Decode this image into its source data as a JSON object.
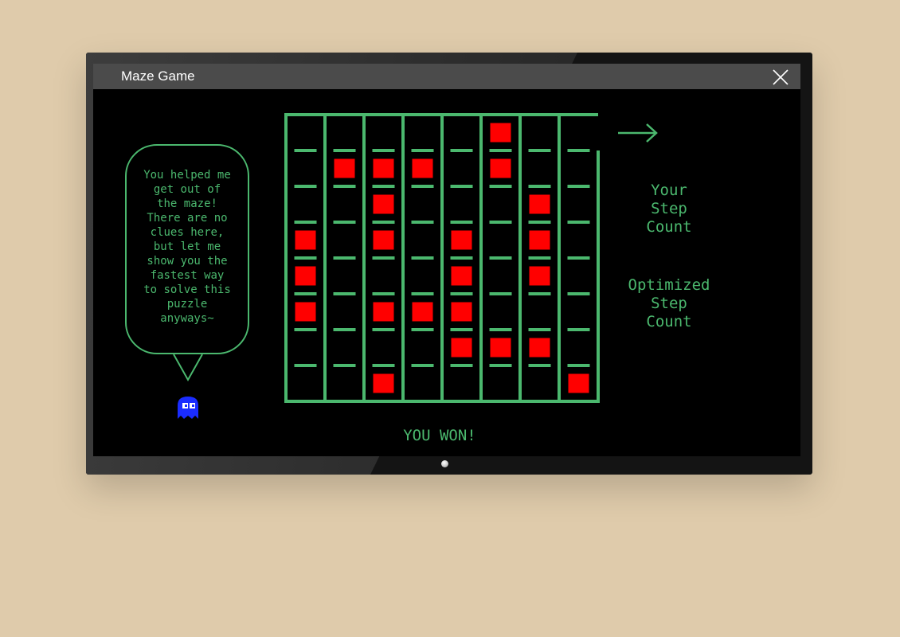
{
  "window": {
    "title": "Maze Game"
  },
  "speech_bubble": {
    "lines": [
      "You helped me",
      "get out of",
      "the maze!",
      "There are no",
      "clues here,",
      "but let me",
      "show you the",
      "fastest way",
      "to solve this",
      "puzzle",
      "anyways~"
    ]
  },
  "stats": {
    "step_count_label": [
      "Your",
      "Step",
      "Count"
    ],
    "optimized_label": [
      "Optimized",
      "Step",
      "Count"
    ]
  },
  "status": {
    "message": "YOU WON!"
  },
  "maze": {
    "columns": 8,
    "rows": 8,
    "red_cells": [
      [
        0,
        5
      ],
      [
        1,
        1
      ],
      [
        1,
        2
      ],
      [
        1,
        3
      ],
      [
        1,
        5
      ],
      [
        2,
        2
      ],
      [
        2,
        6
      ],
      [
        3,
        0
      ],
      [
        3,
        2
      ],
      [
        3,
        4
      ],
      [
        3,
        6
      ],
      [
        4,
        0
      ],
      [
        4,
        4
      ],
      [
        4,
        6
      ],
      [
        5,
        0
      ],
      [
        5,
        2
      ],
      [
        5,
        3
      ],
      [
        5,
        4
      ],
      [
        6,
        4
      ],
      [
        6,
        5
      ],
      [
        6,
        6
      ],
      [
        7,
        2
      ],
      [
        7,
        7
      ]
    ]
  },
  "colors": {
    "maze_green": "#4bb86e",
    "block_red": "#ff0000",
    "ghost_blue": "#1a2cff",
    "background": "#dfcbab"
  },
  "icons": {
    "close": "close-icon",
    "ghost": "ghost-icon",
    "exit": "arrow-right-icon"
  }
}
